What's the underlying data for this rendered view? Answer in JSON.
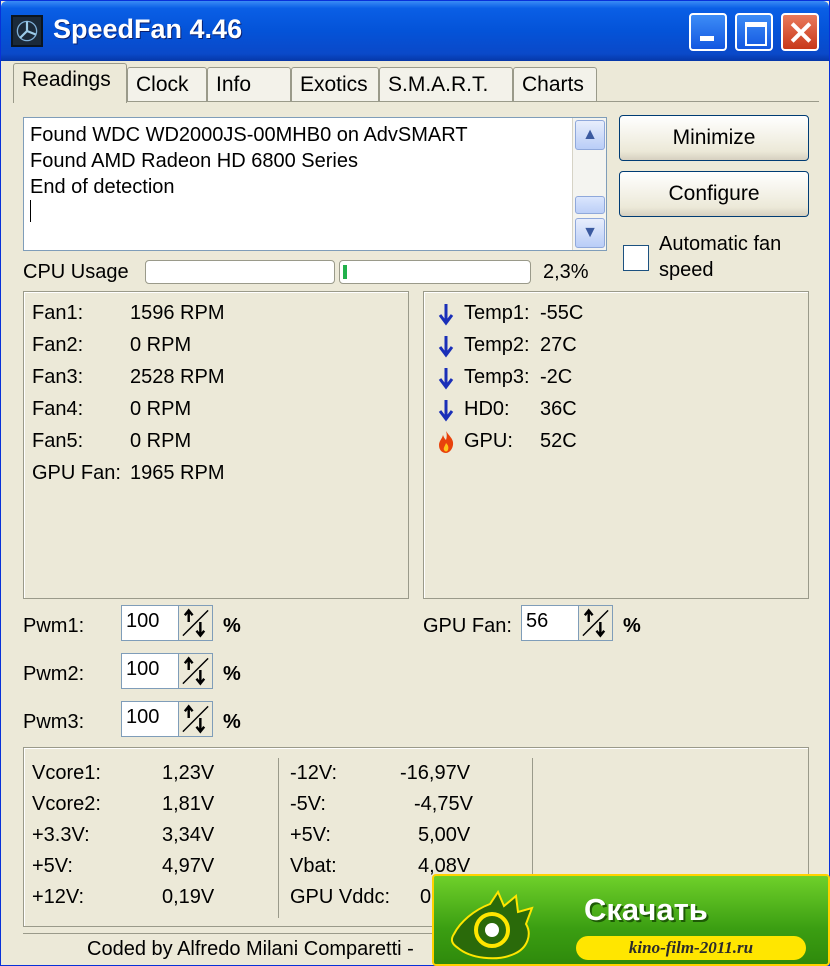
{
  "window": {
    "title": "SpeedFan 4.46"
  },
  "tabs": [
    {
      "label": "Readings"
    },
    {
      "label": "Clock"
    },
    {
      "label": "Info"
    },
    {
      "label": "Exotics"
    },
    {
      "label": "S.M.A.R.T."
    },
    {
      "label": "Charts"
    }
  ],
  "log": {
    "lines": [
      "Found WDC WD2000JS-00MHB0 on AdvSMART",
      "Found AMD Radeon HD 6800 Series",
      "End of detection"
    ]
  },
  "buttons": {
    "minimize": "Minimize",
    "configure": "Configure"
  },
  "auto_fan": {
    "label": "Automatic fan speed",
    "checked": false
  },
  "cpu": {
    "label": "CPU Usage",
    "value": "2,3%",
    "bar1_fraction": 0.0,
    "bar2_fraction": 0.023
  },
  "fans": [
    {
      "label": "Fan1:",
      "value": "1596 RPM"
    },
    {
      "label": "Fan2:",
      "value": "0 RPM"
    },
    {
      "label": "Fan3:",
      "value": "2528 RPM"
    },
    {
      "label": "Fan4:",
      "value": "0 RPM"
    },
    {
      "label": "Fan5:",
      "value": "0 RPM"
    },
    {
      "label": "GPU Fan:",
      "value": "1965 RPM"
    }
  ],
  "temps": [
    {
      "label": "Temp1:",
      "value": "-55C",
      "icon": "arrow-down-icon"
    },
    {
      "label": "Temp2:",
      "value": "27C",
      "icon": "arrow-down-icon"
    },
    {
      "label": "Temp3:",
      "value": "-2C",
      "icon": "arrow-down-icon"
    },
    {
      "label": "HD0:",
      "value": "36C",
      "icon": "arrow-down-icon"
    },
    {
      "label": "GPU:",
      "value": "52C",
      "icon": "flame-icon"
    }
  ],
  "pwm": [
    {
      "label": "Pwm1:",
      "value": "100",
      "unit": "%"
    },
    {
      "label": "Pwm2:",
      "value": "100",
      "unit": "%"
    },
    {
      "label": "Pwm3:",
      "value": "100",
      "unit": "%"
    }
  ],
  "gpu_fan_ctrl": {
    "label": "GPU Fan:",
    "value": "56",
    "unit": "%"
  },
  "voltages_left": [
    {
      "label": "Vcore1:",
      "value": "1,23V"
    },
    {
      "label": "Vcore2:",
      "value": "1,81V"
    },
    {
      "label": "+3.3V:",
      "value": "3,34V"
    },
    {
      "label": "+5V:",
      "value": "4,97V"
    },
    {
      "label": "+12V:",
      "value": "0,19V"
    }
  ],
  "voltages_right": [
    {
      "label": "-12V:",
      "value": "-16,97V"
    },
    {
      "label": "-5V:",
      "value": "-4,75V"
    },
    {
      "label": "+5V:",
      "value": "5,00V"
    },
    {
      "label": "Vbat:",
      "value": "4,08V"
    },
    {
      "label": "GPU Vddc:",
      "value": "0"
    }
  ],
  "status": {
    "text": "Coded by Alfredo Milani Comparetti -"
  },
  "ad": {
    "title": "Скачать",
    "url": "kino-film-2011.ru"
  },
  "colors": {
    "titlebar": "#0453d8",
    "arrow": "#1a2fb8",
    "flame": "#e8420c",
    "progress": "#22b14c",
    "ad_green": "#3b9e12",
    "ad_yellow": "#ffe600"
  }
}
